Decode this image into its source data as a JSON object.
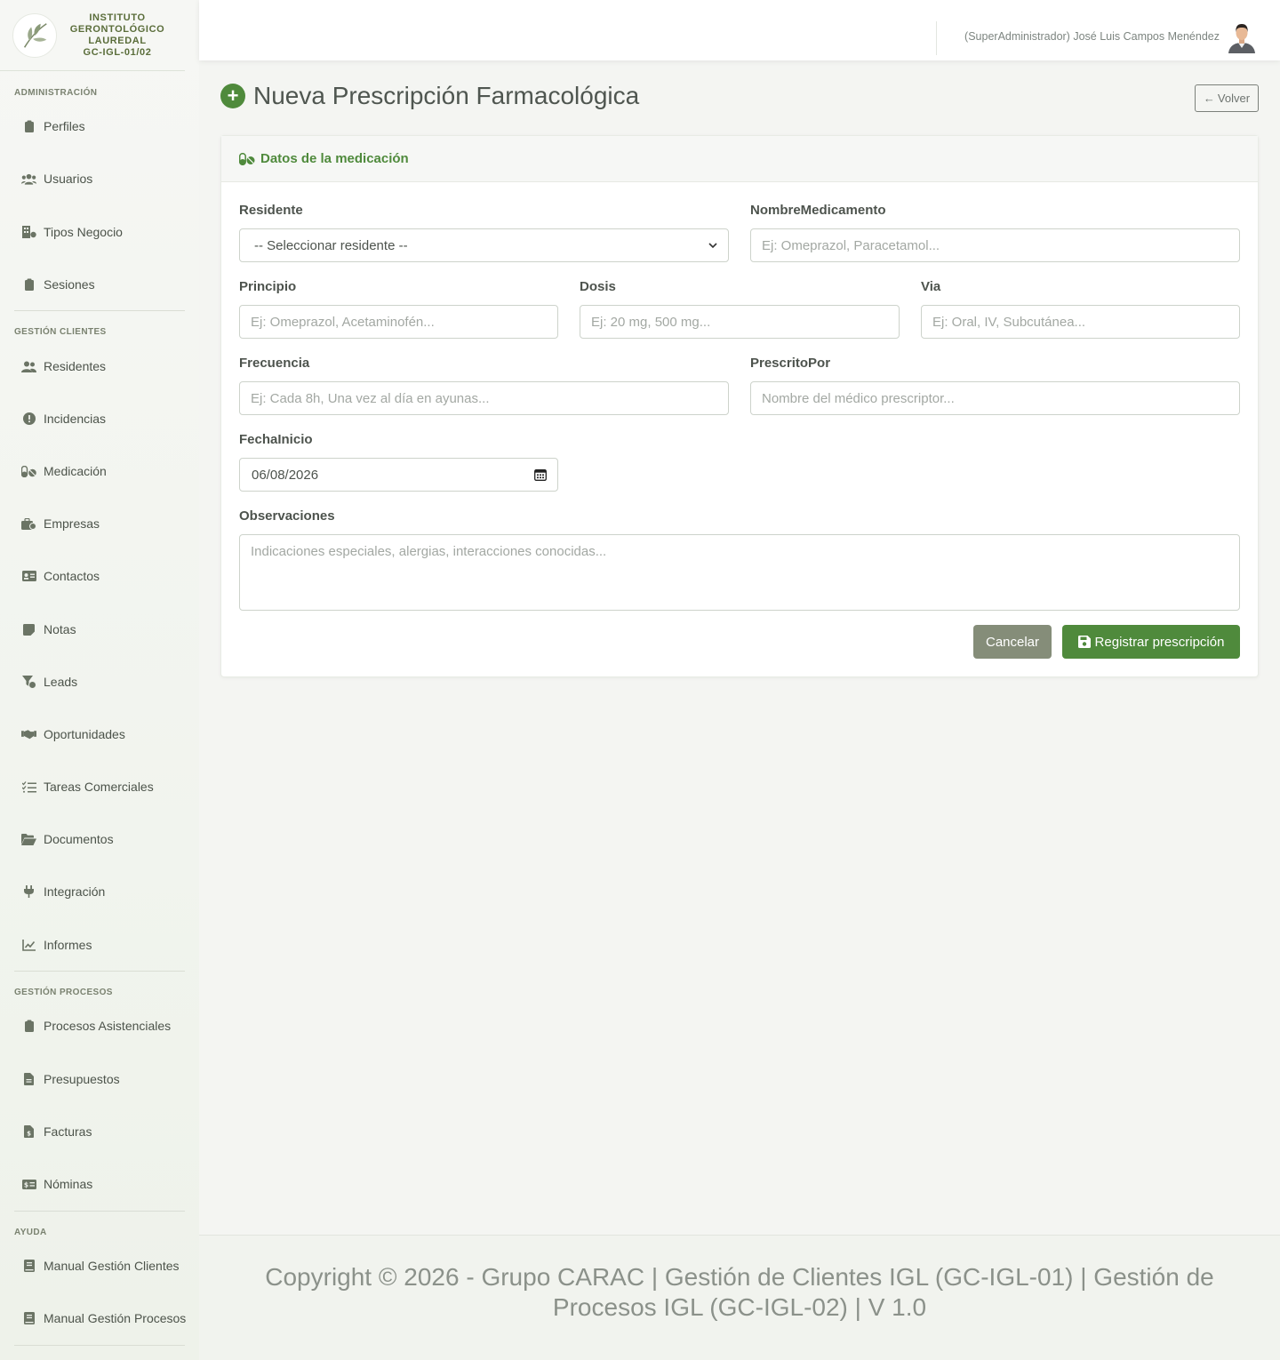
{
  "brand": {
    "line1": "INSTITUTO",
    "line2": "GERONTOLÓGICO",
    "line3": "LAUREDAL",
    "line4": "GC-IGL-01/02"
  },
  "sidebar": {
    "sections": [
      {
        "heading": "ADMINISTRACIÓN"
      },
      {
        "heading": "GESTIÓN CLIENTES"
      },
      {
        "heading": "GESTIÓN PROCESOS"
      },
      {
        "heading": "AYUDA"
      }
    ],
    "items": [
      {
        "label": "Perfiles",
        "icon": "clipboard-icon"
      },
      {
        "label": "Usuarios",
        "icon": "users-icon"
      },
      {
        "label": "Tipos Negocio",
        "icon": "building-icon"
      },
      {
        "label": "Sesiones",
        "icon": "clipboard-icon"
      },
      {
        "label": "Residentes",
        "icon": "user-group-icon"
      },
      {
        "label": "Incidencias",
        "icon": "alert-circle-icon"
      },
      {
        "label": "Medicación",
        "icon": "pills-icon"
      },
      {
        "label": "Empresas",
        "icon": "briefcase-icon"
      },
      {
        "label": "Contactos",
        "icon": "id-card-icon"
      },
      {
        "label": "Notas",
        "icon": "sticky-note-icon"
      },
      {
        "label": "Leads",
        "icon": "funnel-icon"
      },
      {
        "label": "Oportunidades",
        "icon": "handshake-icon"
      },
      {
        "label": "Tareas Comerciales",
        "icon": "task-list-icon"
      },
      {
        "label": "Documentos",
        "icon": "folder-open-icon"
      },
      {
        "label": "Integración",
        "icon": "plug-icon"
      },
      {
        "label": "Informes",
        "icon": "chart-line-icon"
      },
      {
        "label": "Procesos Asistenciales",
        "icon": "clipboard-icon"
      },
      {
        "label": "Presupuestos",
        "icon": "file-icon"
      },
      {
        "label": "Facturas",
        "icon": "invoice-icon"
      },
      {
        "label": "Nóminas",
        "icon": "money-icon"
      },
      {
        "label": "Manual Gestión Clientes",
        "icon": "book-icon"
      },
      {
        "label": "Manual Gestión Procesos",
        "icon": "book-icon"
      }
    ]
  },
  "topbar": {
    "user": "(SuperAdministrador) José Luis Campos Menéndez"
  },
  "page": {
    "title": "Nueva Prescripción Farmacológica",
    "back_label": "Volver"
  },
  "card": {
    "header": "Datos de la medicación"
  },
  "form": {
    "residente_label": "Residente",
    "residente_value": "-- Seleccionar residente --",
    "nombre_label": "NombreMedicamento",
    "nombre_placeholder": "Ej: Omeprazol, Paracetamol...",
    "principio_label": "Principio",
    "principio_placeholder": "Ej: Omeprazol, Acetaminofén...",
    "dosis_label": "Dosis",
    "dosis_placeholder": "Ej: 20 mg, 500 mg...",
    "via_label": "Via",
    "via_placeholder": "Ej: Oral, IV, Subcutánea...",
    "frecuencia_label": "Frecuencia",
    "frecuencia_placeholder": "Ej: Cada 8h, Una vez al día en ayunas...",
    "prescrito_label": "PrescritoPor",
    "prescrito_placeholder": "Nombre del médico prescriptor...",
    "fecha_label": "FechaInicio",
    "fecha_value": "06/08/2026",
    "observaciones_label": "Observaciones",
    "observaciones_placeholder": "Indicaciones especiales, alergias, interacciones conocidas...",
    "cancel_label": "Cancelar",
    "submit_label": "Registrar prescripción"
  },
  "footer": {
    "line1": "Copyright © 2026 - Grupo CARAC | Gestión de Clientes IGL (GC-IGL-01) | Gestión de",
    "line2": "Procesos IGL (GC-IGL-02) | V 1.0"
  },
  "colors": {
    "accent": "#4f8a3c",
    "cancel": "#858d79"
  }
}
